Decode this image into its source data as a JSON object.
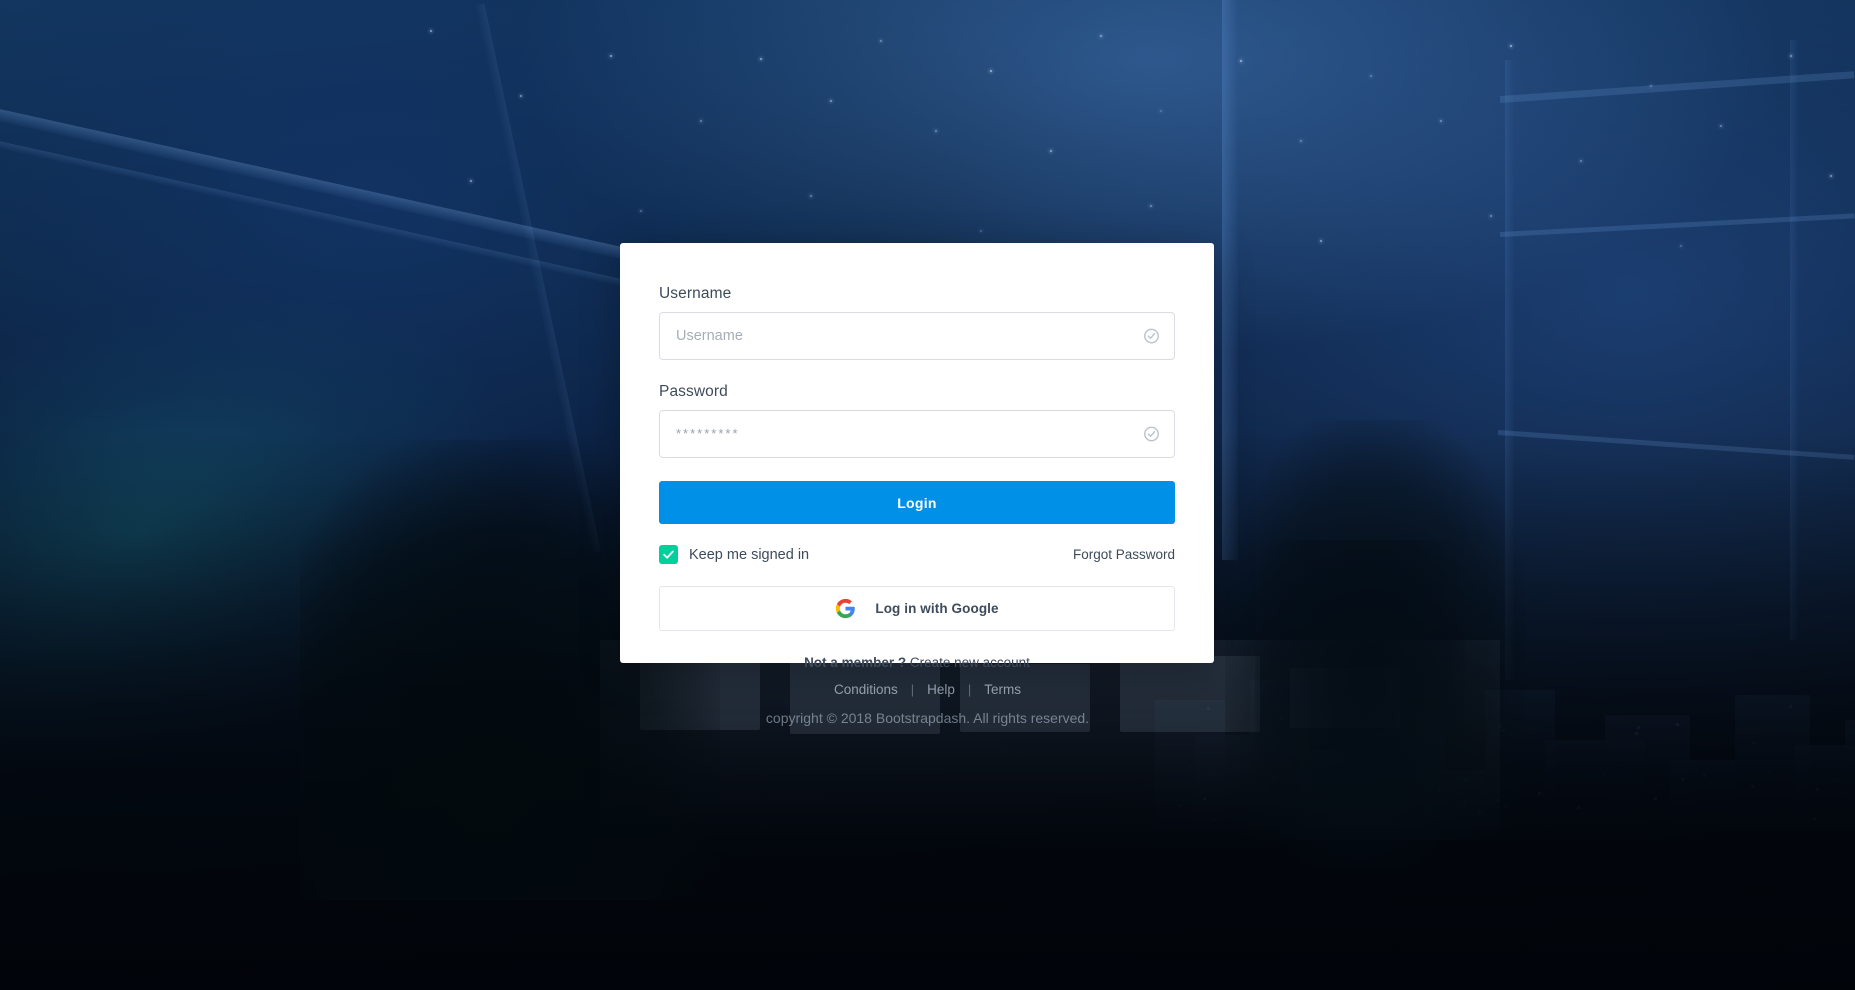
{
  "background": {
    "scene_description": "night-office-window-cityscape",
    "overlay_color": "#0a1b33"
  },
  "login_card": {
    "username": {
      "label": "Username",
      "placeholder": "Username",
      "value": "",
      "icon": "check-circle-icon"
    },
    "password": {
      "label": "Password",
      "placeholder": "*********",
      "value": "",
      "icon": "check-circle-icon"
    },
    "login_button": {
      "label": "Login",
      "color": "#0090e7"
    },
    "keep_signed_in": {
      "label": "Keep me signed in",
      "checked": true,
      "color": "#00d09c"
    },
    "forgot_password": {
      "label": "Forgot Password"
    },
    "google_button": {
      "label": "Log in with Google",
      "icon": "google-g-icon"
    },
    "signup": {
      "prompt": "Not a member ?",
      "link": "Create new account"
    }
  },
  "footer": {
    "links": [
      {
        "label": "Conditions"
      },
      {
        "label": "Help"
      },
      {
        "label": "Terms"
      }
    ],
    "separator": "|",
    "copyright": "copyright © 2018 Bootstrapdash. All rights reserved."
  }
}
